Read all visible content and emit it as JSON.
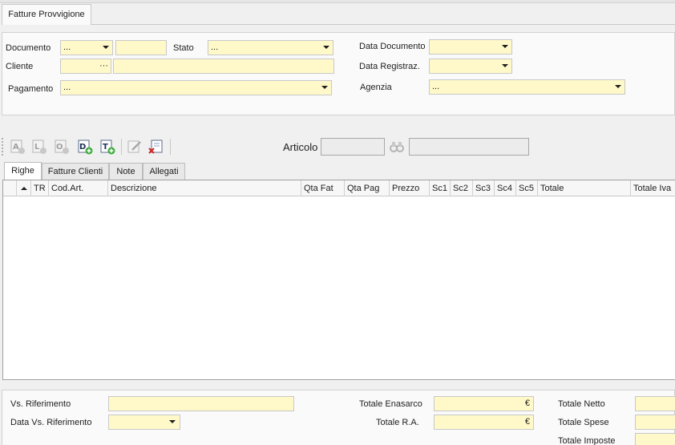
{
  "window": {
    "tab_title": "Fatture Provvigione"
  },
  "header": {
    "documento_label": "Documento",
    "documento_value": "...",
    "documento_number": "",
    "stato_label": "Stato",
    "stato_value": "...",
    "cliente_label": "Cliente",
    "cliente_code": "",
    "cliente_name": "",
    "pagamento_label": "Pagamento",
    "pagamento_value": "...",
    "data_documento_label": "Data Documento",
    "data_documento_value": "",
    "data_registraz_label": "Data Registraz.",
    "data_registraz_value": "",
    "agenzia_label": "Agenzia",
    "agenzia_value": "..."
  },
  "toolbar": {
    "articolo_label": "Articolo",
    "articolo_code": "",
    "articolo_desc": "",
    "buttons": [
      "add-a",
      "add-l",
      "add-o",
      "add-d",
      "add-t",
      "edit",
      "delete"
    ]
  },
  "subtabs": [
    "Righe",
    "Fatture Clienti",
    "Note",
    "Allegati"
  ],
  "grid": {
    "columns": [
      "",
      "",
      "TR",
      "Cod.Art.",
      "Descrizione",
      "Qta Fat",
      "Qta Pag",
      "Prezzo",
      "Sc1",
      "Sc2",
      "Sc3",
      "Sc4",
      "Sc5",
      "Totale",
      "Totale Iva"
    ],
    "rows": []
  },
  "footer": {
    "vs_riferimento_label": "Vs. Riferimento",
    "vs_riferimento_value": "",
    "data_vs_riferimento_label": "Data Vs. Riferimento",
    "data_vs_riferimento_value": "",
    "totale_enasarco_label": "Totale Enasarco",
    "totale_ra_label": "Totale R.A.",
    "currency_symbol": "€",
    "totale_netto_label": "Totale Netto",
    "totale_spese_label": "Totale Spese",
    "totale_imposte_label": "Totale Imposte"
  },
  "colors": {
    "field_yellow": "#fff9c9",
    "panel_bg": "#fafafa",
    "window_bg": "#f0f0f0"
  }
}
